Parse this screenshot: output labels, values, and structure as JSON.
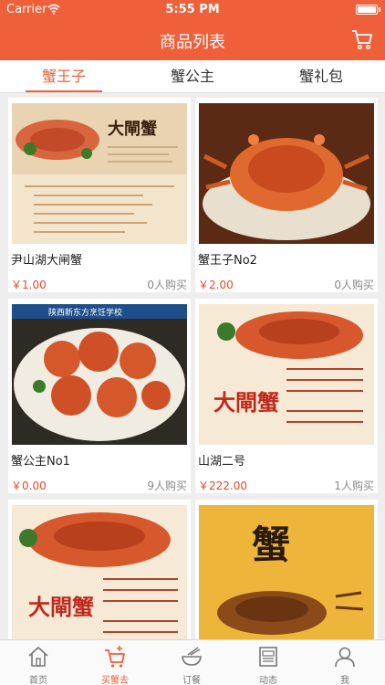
{
  "status": {
    "carrier": "Carrier",
    "time": "5:55 PM"
  },
  "nav": {
    "title": "商品列表"
  },
  "tabs": [
    {
      "label": "蟹王子",
      "active": true
    },
    {
      "label": "蟹公主",
      "active": false
    },
    {
      "label": "蟹礼包",
      "active": false
    }
  ],
  "products": [
    {
      "name": "尹山湖大闸蟹",
      "price": "￥1.00",
      "buyers": "0人购买",
      "img_text": "大閘蟹"
    },
    {
      "name": "蟹王子No2",
      "price": "￥2.00",
      "buyers": "0人购买",
      "img_text": ""
    },
    {
      "name": "蟹公主No1",
      "price": "￥0.00",
      "buyers": "9人购买",
      "img_text": "陕西新东方烹饪学校"
    },
    {
      "name": "山湖二号",
      "price": "￥222.00",
      "buyers": "1人购买",
      "img_text": "大閘蟹"
    },
    {
      "name": "",
      "price": "",
      "buyers": "",
      "img_text": "大閘蟹"
    },
    {
      "name": "",
      "price": "",
      "buyers": "",
      "img_text": "蟹"
    }
  ],
  "tabbar": [
    {
      "label": "首页",
      "icon": "home-icon",
      "active": false
    },
    {
      "label": "买蟹去",
      "icon": "cart-icon",
      "active": true
    },
    {
      "label": "订餐",
      "icon": "bowl-icon",
      "active": false
    },
    {
      "label": "动态",
      "icon": "news-icon",
      "active": false
    },
    {
      "label": "我",
      "icon": "user-icon",
      "active": false
    }
  ],
  "colors": {
    "accent": "#ef5f3a",
    "price": "#e24a2a"
  }
}
